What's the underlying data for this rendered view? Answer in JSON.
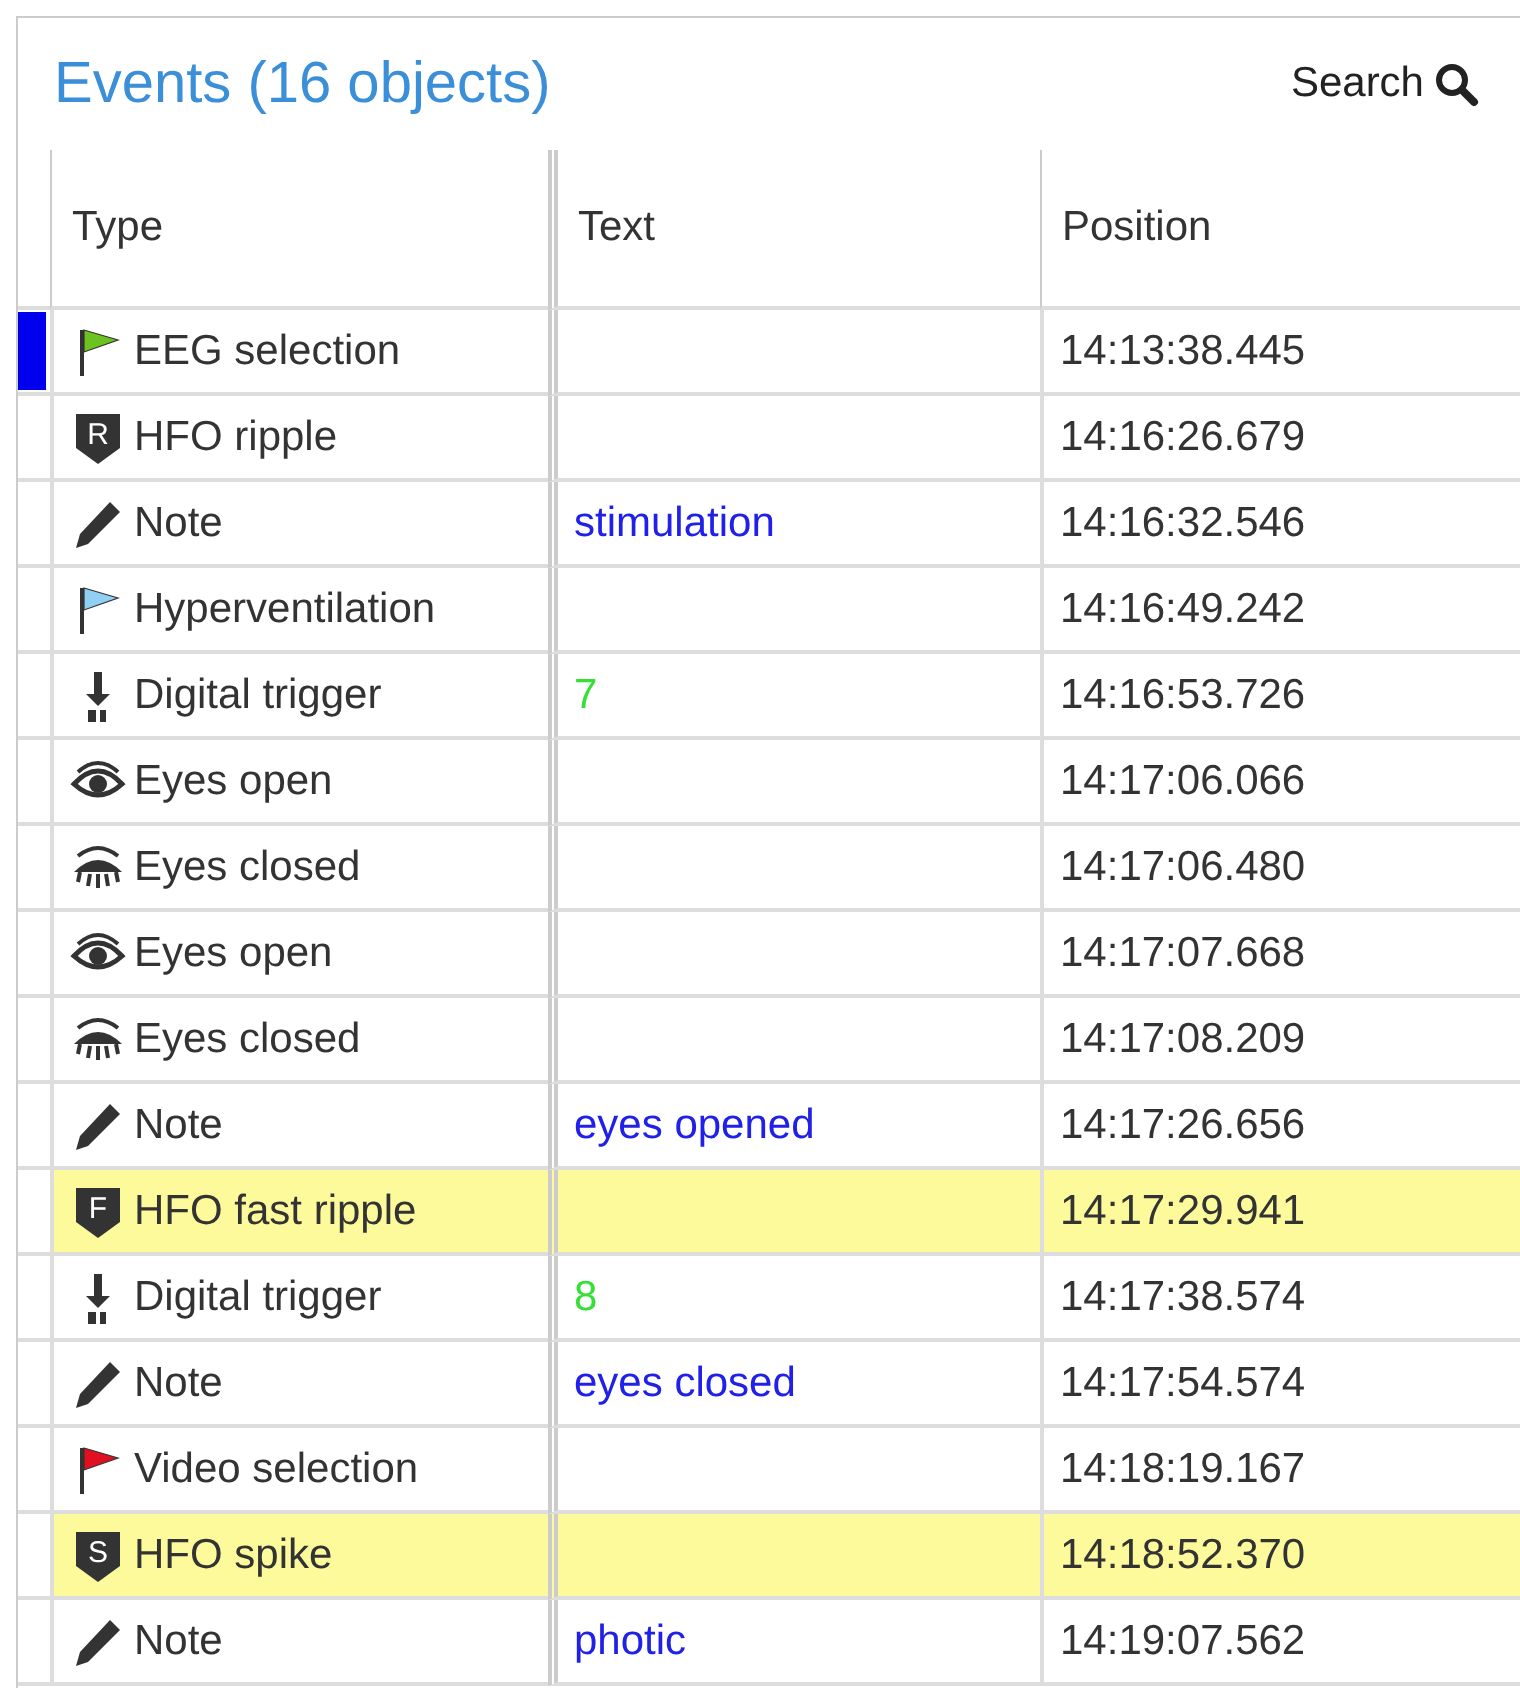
{
  "title": "Events (16 objects)",
  "search": {
    "label": "Search"
  },
  "columns": [
    "Type",
    "Text",
    "Position"
  ],
  "rows": [
    {
      "kind": "flag",
      "color": "#6cc21e",
      "type": "EEG selection",
      "position": "14:13:38.445",
      "marked": true,
      "highlighted": false
    },
    {
      "kind": "shield",
      "badge": "R",
      "type": "HFO ripple",
      "position": "14:16:26.679",
      "marked": false,
      "highlighted": false
    },
    {
      "kind": "pencil",
      "type": "Note",
      "text": {
        "value": "stimulation",
        "color": "#2020e8"
      },
      "position": "14:16:32.546",
      "marked": false,
      "highlighted": false
    },
    {
      "kind": "flag",
      "color": "#8fd0f4",
      "type": "Hyperventilation",
      "position": "14:16:49.242",
      "marked": false,
      "highlighted": false
    },
    {
      "kind": "trigger",
      "type": "Digital trigger",
      "text": {
        "value": "7",
        "color": "#33e033"
      },
      "position": "14:16:53.726",
      "marked": false,
      "highlighted": false
    },
    {
      "kind": "eye-open",
      "type": "Eyes open",
      "position": "14:17:06.066",
      "marked": false,
      "highlighted": false
    },
    {
      "kind": "eye-closed",
      "type": "Eyes closed",
      "position": "14:17:06.480",
      "marked": false,
      "highlighted": false
    },
    {
      "kind": "eye-open",
      "type": "Eyes open",
      "position": "14:17:07.668",
      "marked": false,
      "highlighted": false
    },
    {
      "kind": "eye-closed",
      "type": "Eyes closed",
      "position": "14:17:08.209",
      "marked": false,
      "highlighted": false
    },
    {
      "kind": "pencil",
      "type": "Note",
      "text": {
        "value": "eyes opened",
        "color": "#2020e8"
      },
      "position": "14:17:26.656",
      "marked": false,
      "highlighted": false
    },
    {
      "kind": "shield",
      "badge": "F",
      "type": "HFO fast ripple",
      "position": "14:17:29.941",
      "marked": false,
      "highlighted": true
    },
    {
      "kind": "trigger",
      "type": "Digital trigger",
      "text": {
        "value": "8",
        "color": "#33e033"
      },
      "position": "14:17:38.574",
      "marked": false,
      "highlighted": false
    },
    {
      "kind": "pencil",
      "type": "Note",
      "text": {
        "value": "eyes closed",
        "color": "#2020e8"
      },
      "position": "14:17:54.574",
      "marked": false,
      "highlighted": false
    },
    {
      "kind": "flag",
      "color": "#e01020",
      "type": "Video selection",
      "position": "14:18:19.167",
      "marked": false,
      "highlighted": false
    },
    {
      "kind": "shield",
      "badge": "S",
      "type": "HFO spike",
      "position": "14:18:52.370",
      "marked": false,
      "highlighted": true
    },
    {
      "kind": "pencil",
      "type": "Note",
      "text": {
        "value": "photic",
        "color": "#2020e8"
      },
      "position": "14:19:07.562",
      "marked": false,
      "highlighted": false
    }
  ]
}
